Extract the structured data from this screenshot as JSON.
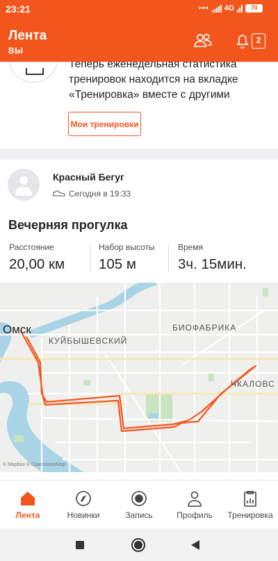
{
  "status_bar": {
    "time": "23:21",
    "dots": "•••",
    "network": "4G",
    "battery": "70"
  },
  "header": {
    "title": "Лента",
    "subtitle": "ВЫ",
    "notification_count": "2",
    "icons": [
      "people-icon",
      "bell-icon",
      "notification-badge-icon"
    ]
  },
  "promo": {
    "text_lines": [
      "Теперь еженедельная статистика",
      "тренировок находится на вкладке",
      "«Тренировка» вместе с другими"
    ],
    "button_label": "Мои тренировки"
  },
  "activity": {
    "athlete_name": "Красный Бегуг",
    "timestamp": "Сегодня в 19:33",
    "title": "Вечерняя прогулка",
    "stats": [
      {
        "label": "Расстояние",
        "value": "20,00 км"
      },
      {
        "label": "Набор высоты",
        "value": "105 м"
      },
      {
        "label": "Время",
        "value": "3ч. 15мин."
      }
    ]
  },
  "map": {
    "city_label": "Омск",
    "district_labels": [
      "КУЙБЫШЕВСКИЙ",
      "БИОФАБРИКА",
      "ЧКАЛОВС"
    ],
    "attribution": "© Mapbox © OpenStreetMap",
    "route_color": "#f2561d"
  },
  "bottom_nav": [
    {
      "label": "Лента",
      "icon": "home-icon",
      "active": true
    },
    {
      "label": "Новинки",
      "icon": "compass-icon",
      "active": false
    },
    {
      "label": "Запись",
      "icon": "record-icon",
      "active": false
    },
    {
      "label": "Профиль",
      "icon": "profile-icon",
      "active": false
    },
    {
      "label": "Тренировка",
      "icon": "training-icon",
      "active": false
    }
  ],
  "colors": {
    "accent": "#f2561d",
    "text": "#242428",
    "map_water": "#a9d4e6",
    "map_park": "#c8e4c0"
  }
}
